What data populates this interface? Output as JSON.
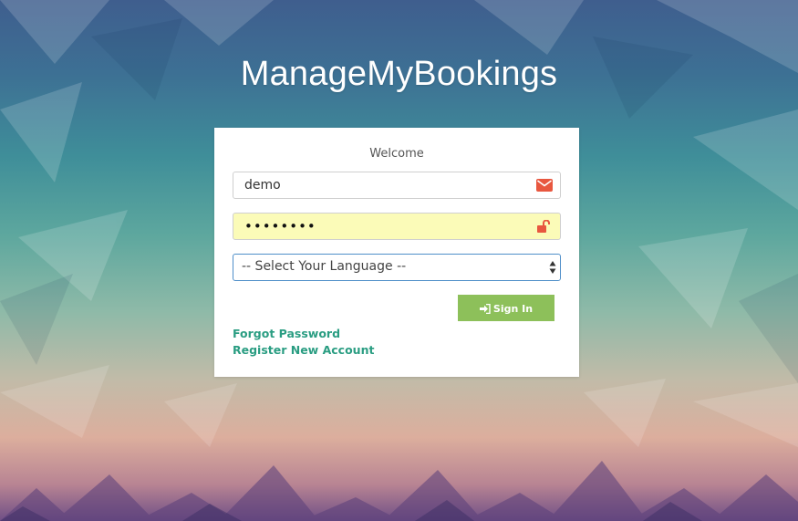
{
  "app": {
    "title": "ManageMyBookings"
  },
  "login_card": {
    "welcome": "Welcome",
    "username": {
      "value": "demo",
      "icon": "envelope-icon"
    },
    "password": {
      "masked_value": "••••••••",
      "icon": "unlock-icon"
    },
    "language_select": {
      "selected": "-- Select Your Language --"
    },
    "sign_in_button": {
      "label": "Sign In",
      "icon": "sign-in-icon"
    },
    "links": {
      "forgot_password": "Forgot Password",
      "register": "Register New Account"
    }
  },
  "colors": {
    "accent_green": "#8dc05a",
    "link_teal": "#2a9d82",
    "icon_orange": "#e8573f",
    "password_autofill_bg": "#fbfbb8",
    "select_focus_border": "#4f8fc9"
  }
}
